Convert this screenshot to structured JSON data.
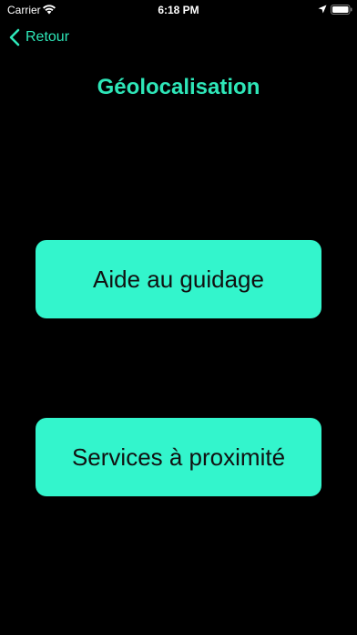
{
  "status_bar": {
    "carrier": "Carrier",
    "time": "6:18 PM",
    "icons": [
      "wifi-icon",
      "location-icon",
      "battery-icon"
    ]
  },
  "nav": {
    "back_label": "Retour",
    "back_icon": "chevron-left-icon"
  },
  "page": {
    "title": "Géolocalisation"
  },
  "buttons": {
    "guidage": "Aide au guidage",
    "services": "Services à proximité"
  },
  "colors": {
    "background": "#000000",
    "accent": "#2ee6b8",
    "button_fill": "#33f5cc",
    "button_text": "#111111"
  }
}
